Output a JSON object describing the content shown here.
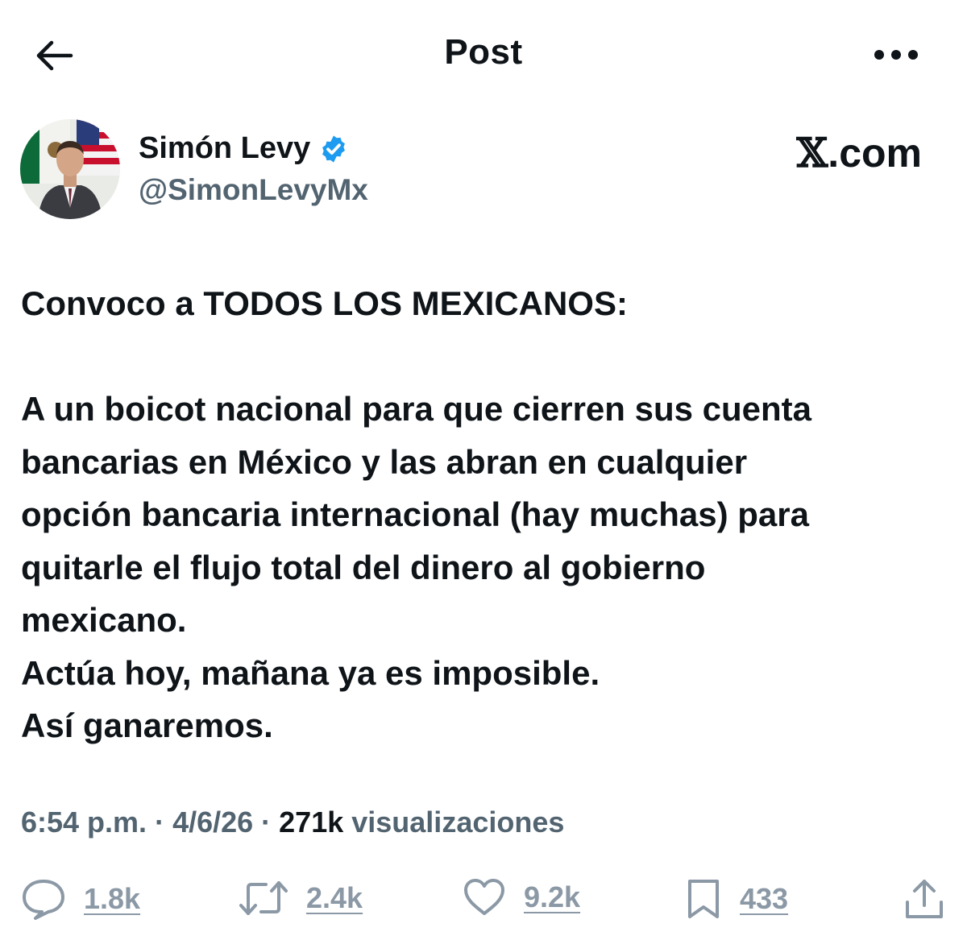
{
  "header": {
    "title": "Post",
    "back_icon": "arrow-left-icon",
    "more_icon": "more-horizontal-icon"
  },
  "author": {
    "name": "Simón Levy",
    "handle": "@SimonLevyMx",
    "verified": true,
    "verified_color": "#1d9bf0"
  },
  "site_mark": {
    "glyph": "𝕏",
    "text": ".com"
  },
  "post": {
    "line1": "Convoco a TODOS LOS MEXICANOS:",
    "line2": "A un boicot nacional para que cierren sus cuenta",
    "line3": "bancarias en México y las abran en cualquier",
    "line4": "opción bancaria internacional (hay muchas) para",
    "line5": "quitarle el flujo total del dinero al gobierno",
    "line6": "mexicano.",
    "line7": "Actúa hoy, mañana ya es imposible.",
    "line8": "Así ganaremos."
  },
  "meta": {
    "time": "6:54 p.m.",
    "sep1": " · ",
    "date": "4/6/26",
    "sep2": " · ",
    "views": "271k",
    "views_label": " visualizaciones"
  },
  "actions": {
    "replies": "1.8k",
    "reposts": "2.4k",
    "likes": "9.2k",
    "bookmarks": "433"
  },
  "colors": {
    "text": "#0f1419",
    "secondary": "#536471",
    "action": "#8b98a5"
  }
}
